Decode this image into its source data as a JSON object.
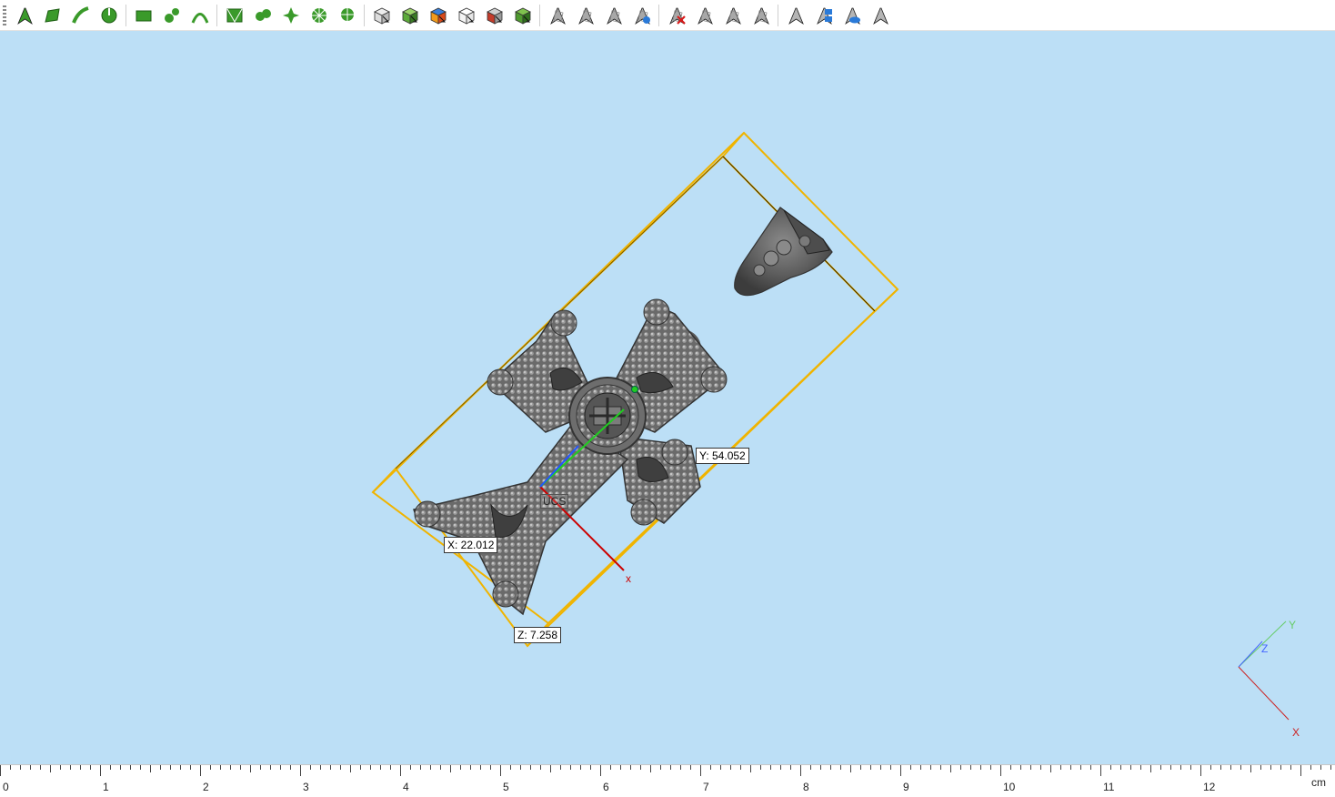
{
  "toolbar": {
    "groups": [
      [
        "select-arrow-icon",
        "select-face-icon",
        "select-edge-icon",
        "select-loop-icon"
      ],
      [
        "select-rectangle-icon",
        "select-nodes-icon",
        "select-curve-icon"
      ],
      [
        "mesh-select-icon",
        "vertex-select-icon",
        "star-select-icon",
        "radial-select-icon",
        "radial-pin-icon"
      ],
      [
        "cube-view-icon",
        "cube-front-icon",
        "cube-colored-icon",
        "cube-wire-icon",
        "cube-shaded-icon",
        "cube-green-icon"
      ],
      [
        "draft-arrow-icon",
        "draft-sweep-icon",
        "draft-extend-icon",
        "draft-loft-icon"
      ],
      [
        "delete-face-icon",
        "offset-face-icon",
        "shell-face-icon",
        "thicken-face-icon"
      ],
      [
        "show-hide-icon",
        "visibility-blue-icon",
        "eye-icon",
        "isolate-icon"
      ]
    ]
  },
  "viewport": {
    "background": "#bcdff6",
    "bbox_color": "#f0b400",
    "dimensions": {
      "x_label": "X: 22.012",
      "y_label": "Y: 54.052",
      "z_label": "Z: 7.258"
    },
    "ucs_label": "UCS",
    "axis_marker_x": "x",
    "triad": {
      "x": "X",
      "y": "Y",
      "z": "Z"
    }
  },
  "ruler": {
    "ticks": [
      "0",
      "1",
      "2",
      "3",
      "4",
      "5",
      "6",
      "7",
      "8",
      "9",
      "10",
      "11",
      "12"
    ],
    "unit": "cm"
  }
}
